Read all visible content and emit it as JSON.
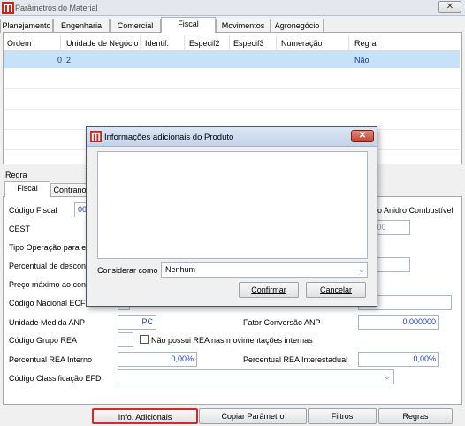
{
  "window": {
    "title": "Parâmetros do Material",
    "close": "✕"
  },
  "tabs": [
    "Planejamento",
    "Engenharia",
    "Comercial",
    "Fiscal",
    "Movimentos",
    "Agronegócio"
  ],
  "grid": {
    "headers": [
      "Ordem",
      "Unidade de Negócio",
      "Identif.",
      "Especif2",
      "Especif3",
      "Numeração",
      "Regra"
    ],
    "row": {
      "ordem": "0",
      "unidade": "2",
      "regra": "Não"
    }
  },
  "regra": {
    "label": "Regra",
    "subtabs": [
      "Fiscal",
      "Contrano"
    ],
    "fields": {
      "codigo_fiscal": {
        "label": "Código Fiscal",
        "value": "00"
      },
      "cest": {
        "label": "CEST"
      },
      "tipo_operacao": {
        "label": "Tipo Operação para ex"
      },
      "percentual_desconto": {
        "label": "Percentual de descont"
      },
      "preco_maximo": {
        "label": "Preço máximo ao cons"
      },
      "codigo_nacional_ecf": {
        "label": "Código Nacional ECF"
      },
      "unidade_medida_anp": {
        "label": "Unidade Medida ANP",
        "value": "PC"
      },
      "fator_conversao_anp": {
        "label": "Fator Conversão ANP",
        "value": "0,000000"
      },
      "codigo_grupo_rea": {
        "label": "Código Grupo REA"
      },
      "nao_possui_rea": {
        "label": "Não possui REA nas movimentações internas"
      },
      "percentual_rea_interno": {
        "label": "Percentual REA Interno",
        "value": "0,00%"
      },
      "percentual_rea_interestadual": {
        "label": "Percentual REA Interestadual",
        "value": "0,00%"
      },
      "codigo_classificacao_efd": {
        "label": "Código Classificação EFD"
      },
      "anidro": {
        "label": "o Anidro Combustível"
      },
      "date_partial": {
        "value": "/00"
      }
    }
  },
  "buttons": {
    "info_adicionais": "Info. Adicionais",
    "copiar_parametro": "Copiar Parâmetro",
    "filtros": "Filtros",
    "regras": "Regras"
  },
  "dialog": {
    "title": "Informações adicionais do Produto",
    "close": "✕",
    "considerar_label": "Considerar como",
    "considerar_value": "Nenhum",
    "confirmar": "Confirmar",
    "cancelar": "Cancelar"
  },
  "colors": {
    "selected_row": "#c6e2f9",
    "value_text": "#1a3fa8",
    "highlight_border": "#d12b2b"
  }
}
